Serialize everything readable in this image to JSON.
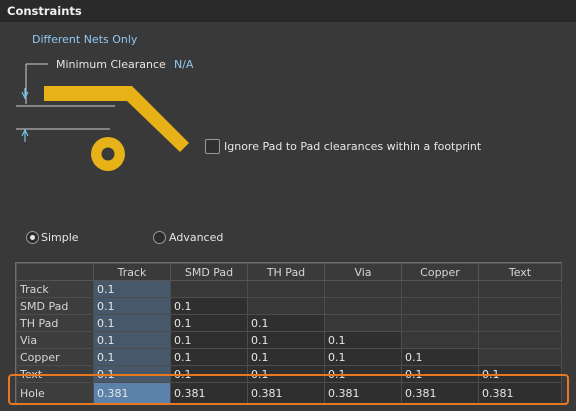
{
  "panel_title": "Constraints",
  "net_scope": "Different Nets Only",
  "min_clearance": {
    "label": "Minimum Clearance",
    "value": "N/A"
  },
  "ignore_pad": {
    "label": "Ignore Pad to Pad clearances within a footprint",
    "checked": false
  },
  "mode": {
    "simple_label": "Simple",
    "advanced_label": "Advanced",
    "selected": "Simple"
  },
  "grid": {
    "columns": [
      "Track",
      "SMD Pad",
      "TH Pad",
      "Via",
      "Copper",
      "Text"
    ],
    "rows": [
      {
        "label": "Track",
        "values": [
          "0.1"
        ]
      },
      {
        "label": "SMD Pad",
        "values": [
          "0.1",
          "0.1"
        ]
      },
      {
        "label": "TH Pad",
        "values": [
          "0.1",
          "0.1",
          "0.1"
        ]
      },
      {
        "label": "Via",
        "values": [
          "0.1",
          "0.1",
          "0.1",
          "0.1"
        ]
      },
      {
        "label": "Copper",
        "values": [
          "0.1",
          "0.1",
          "0.1",
          "0.1",
          "0.1"
        ]
      },
      {
        "label": "Text",
        "values": [
          "0.1",
          "0.1",
          "0.1",
          "0.1",
          "0.1",
          "0.1"
        ]
      },
      {
        "label": "Hole",
        "values": [
          "0.381",
          "0.381",
          "0.381",
          "0.381",
          "0.381",
          "0.381"
        ]
      }
    ]
  },
  "colors": {
    "copper": "#e6b218",
    "highlight": "#e87722",
    "accent_text": "#8ec9f2"
  }
}
